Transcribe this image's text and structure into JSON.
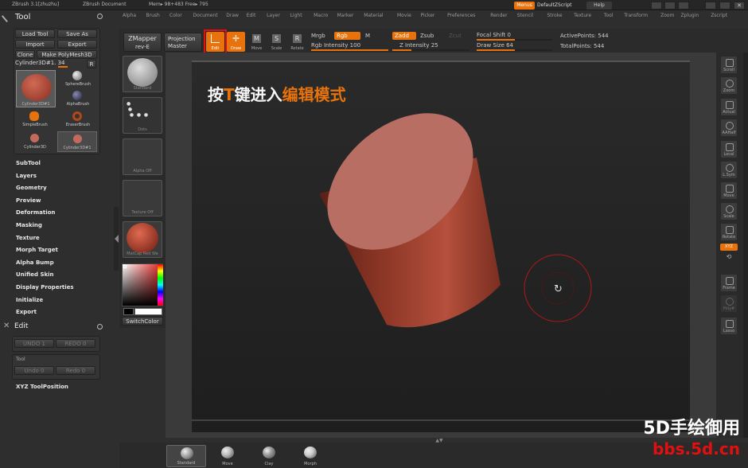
{
  "titlebar": {
    "app": "ZBrush 3.1[zhuzhu]",
    "document": "ZBrush Document",
    "mem": "Mem▸ 98+483 Free▸ 795",
    "menus_btn": "Menus",
    "script_btn": "DefaultZScript",
    "help_btn": "Help"
  },
  "menubar": [
    "Alpha",
    "Brush",
    "Color",
    "Document",
    "Draw",
    "Edit",
    "Layer",
    "Light",
    "Macro",
    "Marker",
    "Material",
    "Movie",
    "Picker",
    "Preferences",
    "Render",
    "Stencil",
    "Stroke",
    "Texture",
    "Tool",
    "Transform",
    "Zoom",
    "Zplugin",
    "Zscript"
  ],
  "tool_panel": {
    "title": "Tool",
    "load_tool": "Load Tool",
    "save_as": "Save As",
    "import": "Import",
    "export": "Export",
    "clone": "Clone",
    "make_polymesh": "Make PolyMesh3D",
    "current_tool": "Cylinder3D#1. 34",
    "r_btn": "R",
    "brushes": [
      {
        "label": "Cylinder3D#1"
      },
      {
        "label": "SphereBrush"
      },
      {
        "label": "AlphaBrush"
      },
      {
        "label": "SimpleBrush"
      },
      {
        "label": "EraserBrush"
      },
      {
        "label": "Cylinder3D"
      },
      {
        "label": "Cylinder3D#1"
      }
    ],
    "sections": [
      "SubTool",
      "Layers",
      "Geometry",
      "Preview",
      "Deformation",
      "Masking",
      "Texture",
      "Morph Target",
      "Alpha Bump",
      "Unified Skin",
      "Display Properties",
      "Initialize",
      "Export"
    ]
  },
  "edit_panel": {
    "title": "Edit",
    "undo": "UNDO 1",
    "redo": "REDO 0",
    "tool_label": "Tool",
    "tool_undo": "Undo 0",
    "tool_redo": "Redo 0",
    "xyz_position": "XYZ ToolPosition"
  },
  "topshelf": {
    "zmapper": "ZMapper",
    "zmapper_sub": "rev-E",
    "projection": "Projection",
    "projection_sub": "Master",
    "edit": "Edit",
    "draw": "Draw",
    "move": "Move",
    "scale": "Scale",
    "rotate": "Rotate",
    "mrgb": "Mrgb",
    "rgb": "Rgb",
    "m": "M",
    "rgb_intensity": "Rgb Intensity 100",
    "zadd": "Zadd",
    "zsub": "Zsub",
    "zcut": "Zcut",
    "z_intensity": "Z Intensity 25",
    "focal_shift": "Focal Shift 0",
    "draw_size": "Draw Size 64",
    "active_points": "ActivePoints: 544",
    "total_points": "TotalPoints: 544",
    "rgb_intensity_value": 100,
    "z_intensity_value": 25,
    "draw_size_value": 64
  },
  "left_shelf": [
    {
      "label": "Standard"
    },
    {
      "label": "Dots"
    },
    {
      "label": "Alpha Off"
    },
    {
      "label": "Texture Off"
    },
    {
      "label": "MatCap Red Wa"
    }
  ],
  "switch_color": "SwitchColor",
  "canvas": {
    "overlay_text_a": "按",
    "overlay_text_key": "T",
    "overlay_text_b": "键进入",
    "overlay_text_c": "编辑模式"
  },
  "right_shelf": [
    "Scroll",
    "Zoom",
    "Actual",
    "AAHalf",
    "Local",
    "L.Sym",
    "Move",
    "Scale",
    "Rotate",
    "XYZ",
    "Frame",
    "Poly#",
    "Lasso"
  ],
  "bottom_shelf": [
    {
      "label": "Standard"
    },
    {
      "label": "Move"
    },
    {
      "label": "Clay"
    },
    {
      "label": "Morph"
    }
  ],
  "watermark": {
    "line1": "5D手绘御用",
    "line2": "bbs.5d.cn"
  },
  "colors": {
    "accent": "#e8720c",
    "cylinder": "#b5503c",
    "highlight_box": "#e01010"
  }
}
